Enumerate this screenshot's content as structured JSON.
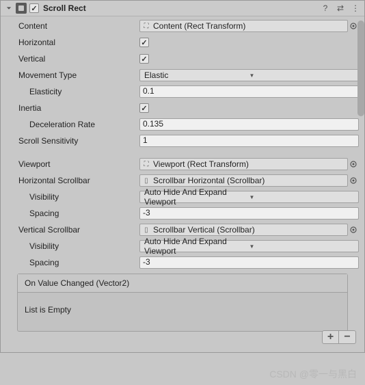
{
  "header": {
    "title": "Scroll Rect",
    "enabled": true
  },
  "fields": {
    "content": {
      "label": "Content",
      "value": "Content (Rect Transform)"
    },
    "horizontal": {
      "label": "Horizontal",
      "checked": true
    },
    "vertical": {
      "label": "Vertical",
      "checked": true
    },
    "movementType": {
      "label": "Movement Type",
      "value": "Elastic"
    },
    "elasticity": {
      "label": "Elasticity",
      "value": "0.1"
    },
    "inertia": {
      "label": "Inertia",
      "checked": true
    },
    "decelerationRate": {
      "label": "Deceleration Rate",
      "value": "0.135"
    },
    "scrollSensitivity": {
      "label": "Scroll Sensitivity",
      "value": "1"
    },
    "viewport": {
      "label": "Viewport",
      "value": "Viewport (Rect Transform)"
    },
    "hScrollbar": {
      "label": "Horizontal Scrollbar",
      "value": "Scrollbar Horizontal (Scrollbar)"
    },
    "hVisibility": {
      "label": "Visibility",
      "value": "Auto Hide And Expand Viewport"
    },
    "hSpacing": {
      "label": "Spacing",
      "value": "-3"
    },
    "vScrollbar": {
      "label": "Vertical Scrollbar",
      "value": "Scrollbar Vertical (Scrollbar)"
    },
    "vVisibility": {
      "label": "Visibility",
      "value": "Auto Hide And Expand Viewport"
    },
    "vSpacing": {
      "label": "Spacing",
      "value": "-3"
    }
  },
  "event": {
    "title": "On Value Changed (Vector2)",
    "body": "List is Empty"
  },
  "watermark": "CSDN @零一与黑白"
}
